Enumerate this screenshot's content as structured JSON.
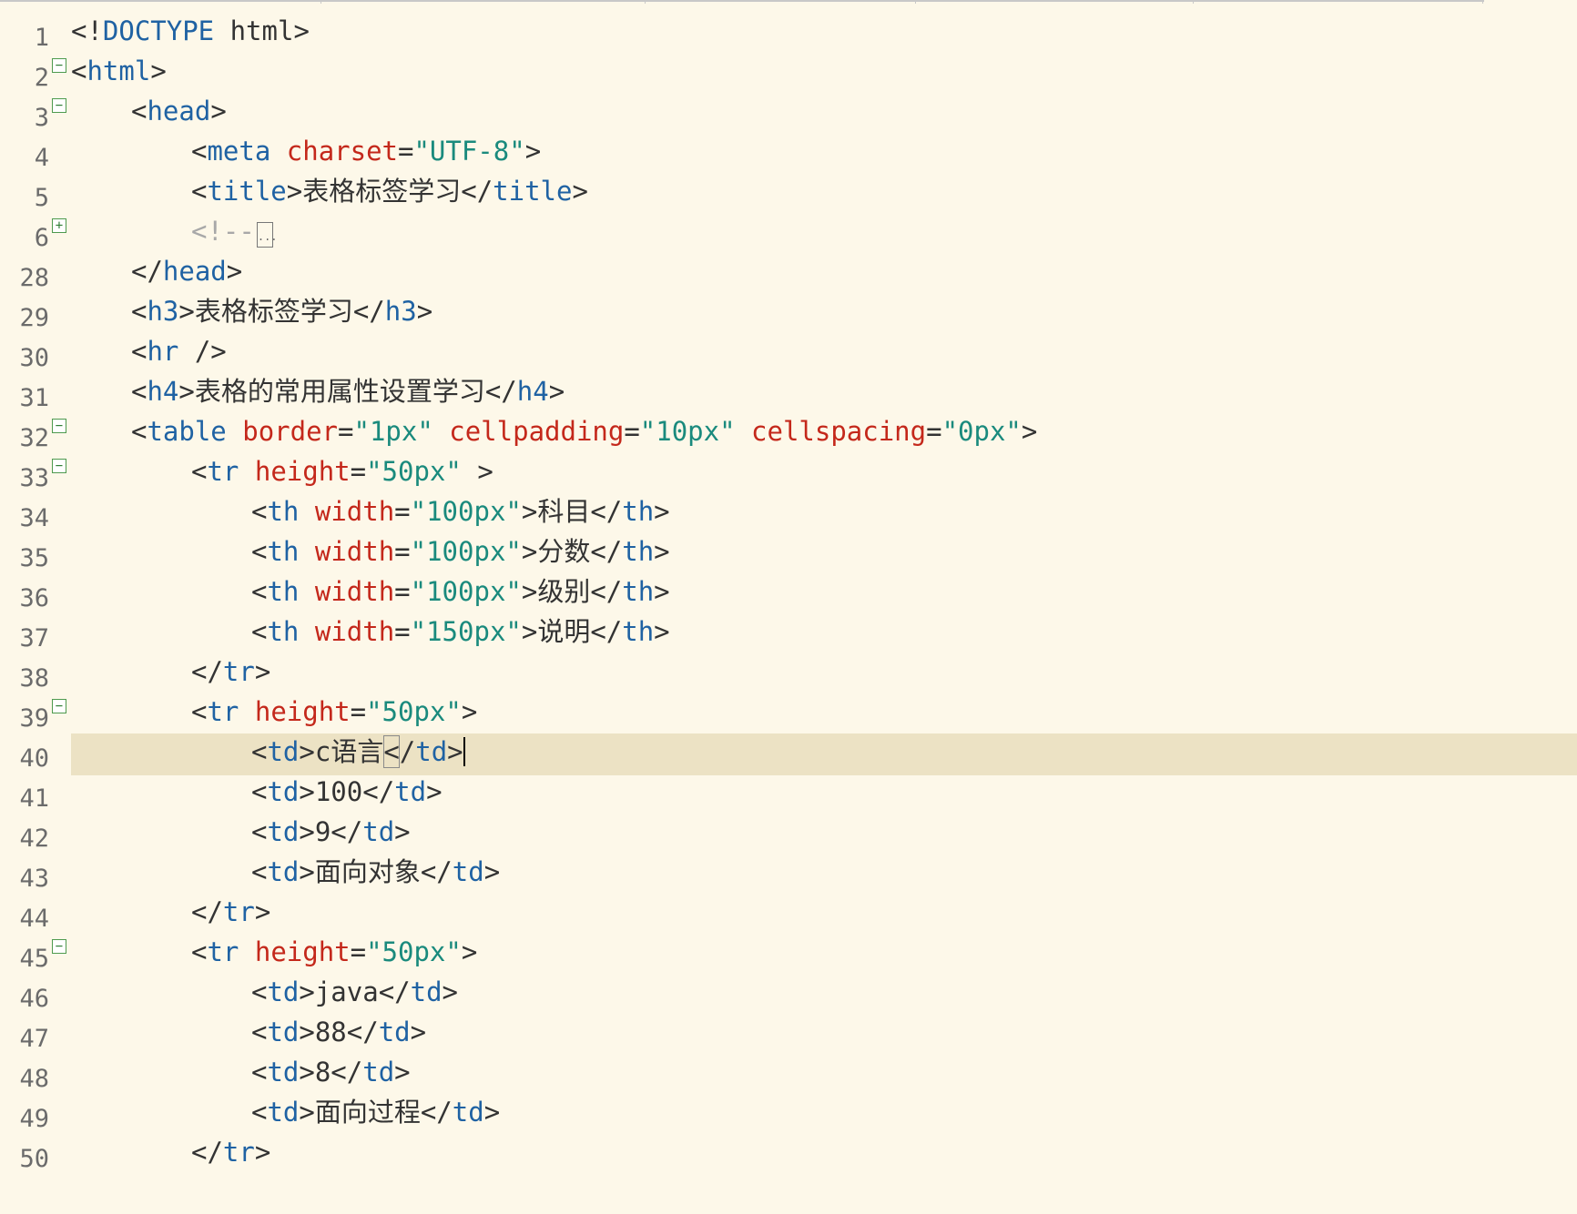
{
  "editor": {
    "language": "html",
    "current_line": 40,
    "lines": [
      {
        "num": "1",
        "fold": "",
        "segs": [
          {
            "t": "<!",
            "c": "p"
          },
          {
            "t": "DOCTYPE",
            "c": "t"
          },
          {
            "t": " html>",
            "c": "p"
          }
        ]
      },
      {
        "num": "2",
        "fold": "−",
        "segs": [
          {
            "t": "<",
            "c": "p"
          },
          {
            "t": "html",
            "c": "t"
          },
          {
            "t": ">",
            "c": "p"
          }
        ]
      },
      {
        "num": "3",
        "fold": "−",
        "segs": [
          {
            "t": "<",
            "c": "p"
          },
          {
            "t": "head",
            "c": "t"
          },
          {
            "t": ">",
            "c": "p"
          }
        ]
      },
      {
        "num": "4",
        "fold": "",
        "segs": [
          {
            "t": "<",
            "c": "p"
          },
          {
            "t": "meta",
            "c": "t"
          },
          {
            "t": " ",
            "c": "p"
          },
          {
            "t": "charset",
            "c": "a"
          },
          {
            "t": "=",
            "c": "p"
          },
          {
            "t": "\"UTF-8\"",
            "c": "v"
          },
          {
            "t": ">",
            "c": "p"
          }
        ]
      },
      {
        "num": "5",
        "fold": "",
        "segs": [
          {
            "t": "<",
            "c": "p"
          },
          {
            "t": "title",
            "c": "t"
          },
          {
            "t": ">表格标签学习</",
            "c": "p"
          },
          {
            "t": "title",
            "c": "t"
          },
          {
            "t": ">",
            "c": "p"
          }
        ]
      },
      {
        "num": "6",
        "fold": "+",
        "segs": [
          {
            "t": "<!--",
            "c": "c"
          }
        ],
        "collapsed": "..."
      },
      {
        "num": "28",
        "fold": "",
        "segs": [
          {
            "t": "</",
            "c": "p"
          },
          {
            "t": "head",
            "c": "t"
          },
          {
            "t": ">",
            "c": "p"
          }
        ]
      },
      {
        "num": "29",
        "fold": "",
        "segs": [
          {
            "t": "<",
            "c": "p"
          },
          {
            "t": "h3",
            "c": "t"
          },
          {
            "t": ">表格标签学习</",
            "c": "p"
          },
          {
            "t": "h3",
            "c": "t"
          },
          {
            "t": ">",
            "c": "p"
          }
        ]
      },
      {
        "num": "30",
        "fold": "",
        "segs": [
          {
            "t": "<",
            "c": "p"
          },
          {
            "t": "hr",
            "c": "t"
          },
          {
            "t": " />",
            "c": "p"
          }
        ]
      },
      {
        "num": "31",
        "fold": "",
        "segs": [
          {
            "t": "<",
            "c": "p"
          },
          {
            "t": "h4",
            "c": "t"
          },
          {
            "t": ">表格的常用属性设置学习</",
            "c": "p"
          },
          {
            "t": "h4",
            "c": "t"
          },
          {
            "t": ">",
            "c": "p"
          }
        ]
      },
      {
        "num": "32",
        "fold": "−",
        "segs": [
          {
            "t": "<",
            "c": "p"
          },
          {
            "t": "table",
            "c": "t"
          },
          {
            "t": " ",
            "c": "p"
          },
          {
            "t": "border",
            "c": "a"
          },
          {
            "t": "=",
            "c": "p"
          },
          {
            "t": "\"1px\"",
            "c": "v"
          },
          {
            "t": " ",
            "c": "p"
          },
          {
            "t": "cellpadding",
            "c": "a"
          },
          {
            "t": "=",
            "c": "p"
          },
          {
            "t": "\"10px\"",
            "c": "v"
          },
          {
            "t": " ",
            "c": "p"
          },
          {
            "t": "cellspacing",
            "c": "a"
          },
          {
            "t": "=",
            "c": "p"
          },
          {
            "t": "\"0px\"",
            "c": "v"
          },
          {
            "t": ">",
            "c": "p"
          }
        ]
      },
      {
        "num": "33",
        "fold": "−",
        "segs": [
          {
            "t": "<",
            "c": "p"
          },
          {
            "t": "tr",
            "c": "t"
          },
          {
            "t": " ",
            "c": "p"
          },
          {
            "t": "height",
            "c": "a"
          },
          {
            "t": "=",
            "c": "p"
          },
          {
            "t": "\"50px\"",
            "c": "v"
          },
          {
            "t": " >",
            "c": "p"
          }
        ]
      },
      {
        "num": "34",
        "fold": "",
        "segs": [
          {
            "t": "<",
            "c": "p"
          },
          {
            "t": "th",
            "c": "t"
          },
          {
            "t": " ",
            "c": "p"
          },
          {
            "t": "width",
            "c": "a"
          },
          {
            "t": "=",
            "c": "p"
          },
          {
            "t": "\"100px\"",
            "c": "v"
          },
          {
            "t": ">科目</",
            "c": "p"
          },
          {
            "t": "th",
            "c": "t"
          },
          {
            "t": ">",
            "c": "p"
          }
        ]
      },
      {
        "num": "35",
        "fold": "",
        "segs": [
          {
            "t": "<",
            "c": "p"
          },
          {
            "t": "th",
            "c": "t"
          },
          {
            "t": " ",
            "c": "p"
          },
          {
            "t": "width",
            "c": "a"
          },
          {
            "t": "=",
            "c": "p"
          },
          {
            "t": "\"100px\"",
            "c": "v"
          },
          {
            "t": ">分数</",
            "c": "p"
          },
          {
            "t": "th",
            "c": "t"
          },
          {
            "t": ">",
            "c": "p"
          }
        ]
      },
      {
        "num": "36",
        "fold": "",
        "segs": [
          {
            "t": "<",
            "c": "p"
          },
          {
            "t": "th",
            "c": "t"
          },
          {
            "t": " ",
            "c": "p"
          },
          {
            "t": "width",
            "c": "a"
          },
          {
            "t": "=",
            "c": "p"
          },
          {
            "t": "\"100px\"",
            "c": "v"
          },
          {
            "t": ">级别</",
            "c": "p"
          },
          {
            "t": "th",
            "c": "t"
          },
          {
            "t": ">",
            "c": "p"
          }
        ]
      },
      {
        "num": "37",
        "fold": "",
        "segs": [
          {
            "t": "<",
            "c": "p"
          },
          {
            "t": "th",
            "c": "t"
          },
          {
            "t": " ",
            "c": "p"
          },
          {
            "t": "width",
            "c": "a"
          },
          {
            "t": "=",
            "c": "p"
          },
          {
            "t": "\"150px\"",
            "c": "v"
          },
          {
            "t": ">说明</",
            "c": "p"
          },
          {
            "t": "th",
            "c": "t"
          },
          {
            "t": ">",
            "c": "p"
          }
        ]
      },
      {
        "num": "38",
        "fold": "",
        "segs": [
          {
            "t": "</",
            "c": "p"
          },
          {
            "t": "tr",
            "c": "t"
          },
          {
            "t": ">",
            "c": "p"
          }
        ]
      },
      {
        "num": "39",
        "fold": "−",
        "segs": [
          {
            "t": "<",
            "c": "p"
          },
          {
            "t": "tr",
            "c": "t"
          },
          {
            "t": " ",
            "c": "p"
          },
          {
            "t": "height",
            "c": "a"
          },
          {
            "t": "=",
            "c": "p"
          },
          {
            "t": "\"50px\"",
            "c": "v"
          },
          {
            "t": ">",
            "c": "p"
          }
        ]
      },
      {
        "num": "40",
        "fold": "",
        "segs": [
          {
            "t": "<",
            "c": "p"
          },
          {
            "t": "td",
            "c": "t"
          },
          {
            "t": ">c语言",
            "c": "p"
          },
          {
            "t": "<",
            "c": "p",
            "box": true
          },
          {
            "t": "/",
            "c": "p"
          },
          {
            "t": "td",
            "c": "t"
          },
          {
            "t": ">",
            "c": "p"
          }
        ],
        "caret": true
      },
      {
        "num": "41",
        "fold": "",
        "segs": [
          {
            "t": "<",
            "c": "p"
          },
          {
            "t": "td",
            "c": "t"
          },
          {
            "t": ">100</",
            "c": "p"
          },
          {
            "t": "td",
            "c": "t"
          },
          {
            "t": ">",
            "c": "p"
          }
        ]
      },
      {
        "num": "42",
        "fold": "",
        "segs": [
          {
            "t": "<",
            "c": "p"
          },
          {
            "t": "td",
            "c": "t"
          },
          {
            "t": ">9</",
            "c": "p"
          },
          {
            "t": "td",
            "c": "t"
          },
          {
            "t": ">",
            "c": "p"
          }
        ]
      },
      {
        "num": "43",
        "fold": "",
        "segs": [
          {
            "t": "<",
            "c": "p"
          },
          {
            "t": "td",
            "c": "t"
          },
          {
            "t": ">面向对象</",
            "c": "p"
          },
          {
            "t": "td",
            "c": "t"
          },
          {
            "t": ">",
            "c": "p"
          }
        ]
      },
      {
        "num": "44",
        "fold": "",
        "segs": [
          {
            "t": "</",
            "c": "p"
          },
          {
            "t": "tr",
            "c": "t"
          },
          {
            "t": ">",
            "c": "p"
          }
        ]
      },
      {
        "num": "45",
        "fold": "−",
        "segs": [
          {
            "t": "<",
            "c": "p"
          },
          {
            "t": "tr",
            "c": "t"
          },
          {
            "t": " ",
            "c": "p"
          },
          {
            "t": "height",
            "c": "a"
          },
          {
            "t": "=",
            "c": "p"
          },
          {
            "t": "\"50px\"",
            "c": "v"
          },
          {
            "t": ">",
            "c": "p"
          }
        ]
      },
      {
        "num": "46",
        "fold": "",
        "segs": [
          {
            "t": "<",
            "c": "p"
          },
          {
            "t": "td",
            "c": "t"
          },
          {
            "t": ">java</",
            "c": "p"
          },
          {
            "t": "td",
            "c": "t"
          },
          {
            "t": ">",
            "c": "p"
          }
        ]
      },
      {
        "num": "47",
        "fold": "",
        "segs": [
          {
            "t": "<",
            "c": "p"
          },
          {
            "t": "td",
            "c": "t"
          },
          {
            "t": ">88</",
            "c": "p"
          },
          {
            "t": "td",
            "c": "t"
          },
          {
            "t": ">",
            "c": "p"
          }
        ]
      },
      {
        "num": "48",
        "fold": "",
        "segs": [
          {
            "t": "<",
            "c": "p"
          },
          {
            "t": "td",
            "c": "t"
          },
          {
            "t": ">8</",
            "c": "p"
          },
          {
            "t": "td",
            "c": "t"
          },
          {
            "t": ">",
            "c": "p"
          }
        ]
      },
      {
        "num": "49",
        "fold": "",
        "segs": [
          {
            "t": "<",
            "c": "p"
          },
          {
            "t": "td",
            "c": "t"
          },
          {
            "t": ">面向过程</",
            "c": "p"
          },
          {
            "t": "td",
            "c": "t"
          },
          {
            "t": ">",
            "c": "p"
          }
        ]
      },
      {
        "num": "50",
        "fold": "",
        "segs": [
          {
            "t": "</",
            "c": "p"
          },
          {
            "t": "tr",
            "c": "t"
          },
          {
            "t": ">",
            "c": "p"
          }
        ]
      }
    ]
  },
  "colors": {
    "background": "#fdf8e9",
    "current_line": "#ece2c4",
    "punctuation": "#333333",
    "tag": "#1f62a3",
    "attribute": "#c4281b",
    "value": "#1a8a7d",
    "comment": "#a8a8a8",
    "gutter": "#6b6b6b",
    "fold_marker": "#2e7d32"
  }
}
